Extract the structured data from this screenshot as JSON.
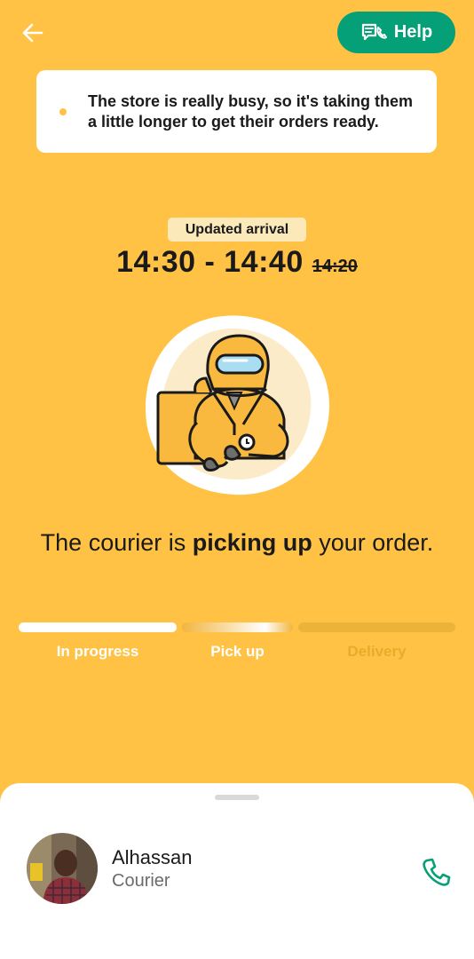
{
  "header": {
    "back_icon": "arrow-left-icon",
    "help_label": "Help",
    "help_icon": "chat-phone-icon"
  },
  "notice": {
    "text": "The store is really busy, so it's taking them a little longer to get their orders ready."
  },
  "arrival": {
    "badge": "Updated arrival",
    "window": "14:30 - 14:40",
    "previous": "14:20"
  },
  "status": {
    "prefix": "The courier is ",
    "emphasis": "picking up",
    "suffix": " your order."
  },
  "steps": [
    {
      "label": "In progress",
      "state": "done"
    },
    {
      "label": "Pick up",
      "state": "active"
    },
    {
      "label": "Delivery",
      "state": "pending"
    }
  ],
  "courier": {
    "name": "Alhassan",
    "role": "Courier",
    "call_icon": "phone-icon"
  },
  "colors": {
    "background": "#FFC244",
    "accent_green": "#06A078",
    "badge": "#FCE9B9"
  }
}
